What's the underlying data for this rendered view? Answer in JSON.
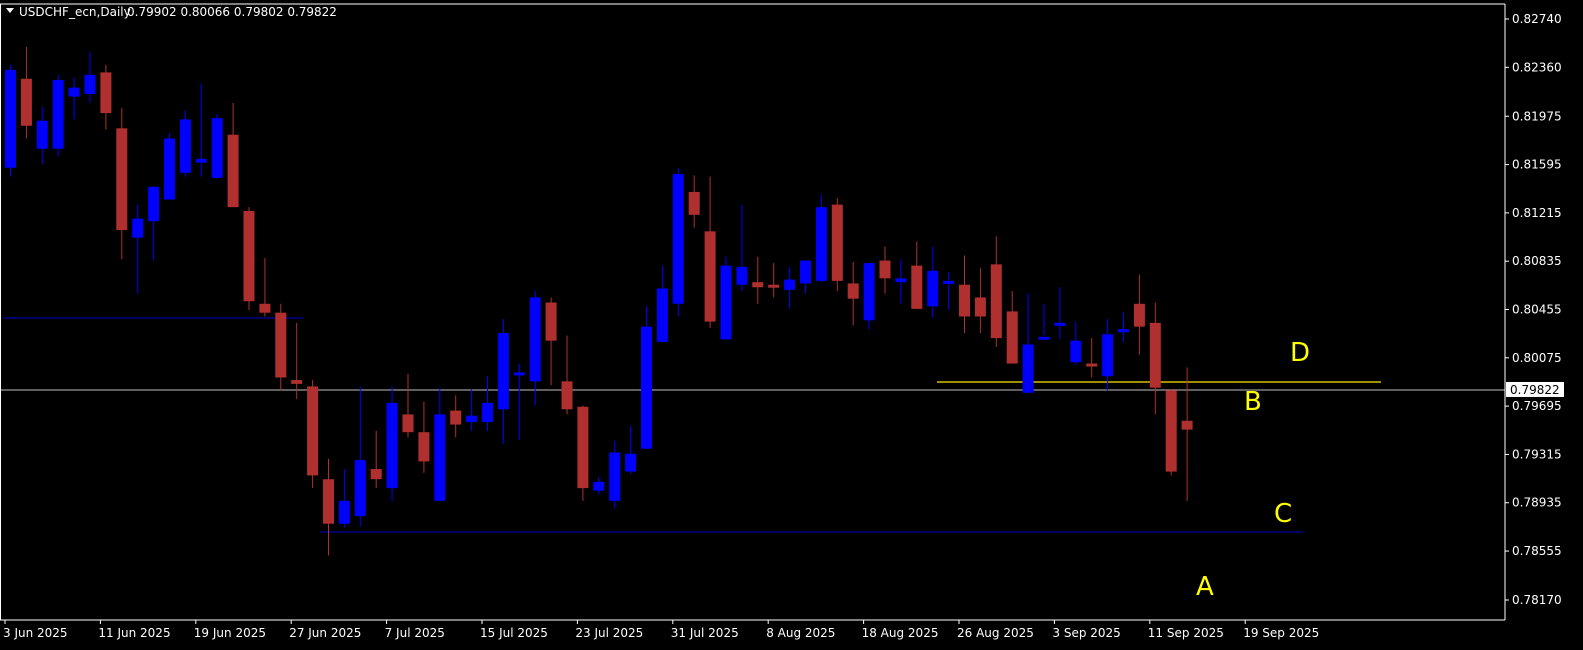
{
  "header": {
    "symbol_timeframe": "USDCHF_ecn,Daily",
    "ohlc": "0.79902 0.80066 0.79802 0.79822"
  },
  "colors": {
    "background": "#000000",
    "bull": "#0000ff",
    "bear": "#b03030",
    "wick_bull": "#0000ff",
    "wick_bear": "#b03030",
    "axis": "#ffffff",
    "hline": "#0000cc",
    "price_line": "#c0c0c0",
    "yellow_line": "#d4c000",
    "annotation": "#ffff00"
  },
  "chart_data": {
    "type": "candlestick",
    "title": "USDCHF_ecn,Daily",
    "ylim": [
      0.7799,
      0.8285
    ],
    "y_ticks": [
      "0.82740",
      "0.82360",
      "0.81975",
      "0.81595",
      "0.81215",
      "0.80835",
      "0.80455",
      "0.80075",
      "0.79695",
      "0.79315",
      "0.78935",
      "0.78555",
      "0.78170"
    ],
    "y_tick_values": [
      0.8274,
      0.8236,
      0.81975,
      0.81595,
      0.81215,
      0.80835,
      0.80455,
      0.80075,
      0.79695,
      0.79315,
      0.78935,
      0.78555,
      0.7817
    ],
    "x_ticks": [
      "3 Jun 2025",
      "11 Jun 2025",
      "19 Jun 2025",
      "27 Jun 2025",
      "7 Jul 2025",
      "15 Jul 2025",
      "23 Jul 2025",
      "31 Jul 2025",
      "8 Aug 2025",
      "18 Aug 2025",
      "26 Aug 2025",
      "3 Sep 2025",
      "11 Sep 2025",
      "19 Sep 2025"
    ],
    "x_tick_index": [
      0,
      6,
      12,
      18,
      24,
      30,
      36,
      42,
      48,
      54,
      60,
      66,
      72,
      78
    ],
    "current_price": "0.79822",
    "current_price_value": 0.79822,
    "candles": [
      {
        "o": 0.8157,
        "h": 0.8238,
        "l": 0.815,
        "c": 0.8234
      },
      {
        "o": 0.8227,
        "h": 0.8252,
        "l": 0.818,
        "c": 0.819
      },
      {
        "o": 0.8172,
        "h": 0.8205,
        "l": 0.816,
        "c": 0.8194
      },
      {
        "o": 0.8172,
        "h": 0.823,
        "l": 0.8166,
        "c": 0.8226
      },
      {
        "o": 0.8213,
        "h": 0.8228,
        "l": 0.8195,
        "c": 0.822
      },
      {
        "o": 0.8215,
        "h": 0.8248,
        "l": 0.8208,
        "c": 0.823
      },
      {
        "o": 0.8232,
        "h": 0.8238,
        "l": 0.8187,
        "c": 0.82
      },
      {
        "o": 0.8188,
        "h": 0.8204,
        "l": 0.8085,
        "c": 0.8108
      },
      {
        "o": 0.8102,
        "h": 0.8128,
        "l": 0.8058,
        "c": 0.8117
      },
      {
        "o": 0.8115,
        "h": 0.8142,
        "l": 0.8084,
        "c": 0.8142
      },
      {
        "o": 0.8132,
        "h": 0.8184,
        "l": 0.8132,
        "c": 0.818
      },
      {
        "o": 0.8153,
        "h": 0.8202,
        "l": 0.815,
        "c": 0.8195
      },
      {
        "o": 0.8161,
        "h": 0.8223,
        "l": 0.815,
        "c": 0.8164
      },
      {
        "o": 0.8149,
        "h": 0.8199,
        "l": 0.8149,
        "c": 0.8196
      },
      {
        "o": 0.8183,
        "h": 0.8208,
        "l": 0.8135,
        "c": 0.8126
      },
      {
        "o": 0.8123,
        "h": 0.8126,
        "l": 0.8045,
        "c": 0.8052
      },
      {
        "o": 0.805,
        "h": 0.8086,
        "l": 0.804,
        "c": 0.8043
      },
      {
        "o": 0.8043,
        "h": 0.805,
        "l": 0.7982,
        "c": 0.7992
      },
      {
        "o": 0.799,
        "h": 0.8035,
        "l": 0.7975,
        "c": 0.7987
      },
      {
        "o": 0.7985,
        "h": 0.799,
        "l": 0.7905,
        "c": 0.7915
      },
      {
        "o": 0.7912,
        "h": 0.7928,
        "l": 0.7852,
        "c": 0.7877
      },
      {
        "o": 0.7877,
        "h": 0.792,
        "l": 0.7874,
        "c": 0.7895
      },
      {
        "o": 0.7883,
        "h": 0.7985,
        "l": 0.7875,
        "c": 0.7927
      },
      {
        "o": 0.792,
        "h": 0.795,
        "l": 0.7905,
        "c": 0.7912
      },
      {
        "o": 0.7905,
        "h": 0.7985,
        "l": 0.7895,
        "c": 0.7972
      },
      {
        "o": 0.7963,
        "h": 0.7995,
        "l": 0.7945,
        "c": 0.7949
      },
      {
        "o": 0.7949,
        "h": 0.7973,
        "l": 0.7917,
        "c": 0.7926
      },
      {
        "o": 0.7895,
        "h": 0.7984,
        "l": 0.7895,
        "c": 0.7963
      },
      {
        "o": 0.7966,
        "h": 0.7978,
        "l": 0.7945,
        "c": 0.7955
      },
      {
        "o": 0.7957,
        "h": 0.7983,
        "l": 0.795,
        "c": 0.7962
      },
      {
        "o": 0.7957,
        "h": 0.7993,
        "l": 0.795,
        "c": 0.7972
      },
      {
        "o": 0.7967,
        "h": 0.8038,
        "l": 0.794,
        "c": 0.8027
      },
      {
        "o": 0.7994,
        "h": 0.8003,
        "l": 0.7943,
        "c": 0.7996
      },
      {
        "o": 0.7989,
        "h": 0.806,
        "l": 0.797,
        "c": 0.8055
      },
      {
        "o": 0.8051,
        "h": 0.8055,
        "l": 0.7986,
        "c": 0.8021
      },
      {
        "o": 0.7989,
        "h": 0.8025,
        "l": 0.7963,
        "c": 0.7967
      },
      {
        "o": 0.7969,
        "h": 0.797,
        "l": 0.7895,
        "c": 0.7905
      },
      {
        "o": 0.7903,
        "h": 0.7914,
        "l": 0.79,
        "c": 0.791
      },
      {
        "o": 0.7895,
        "h": 0.7942,
        "l": 0.7889,
        "c": 0.7933
      },
      {
        "o": 0.7918,
        "h": 0.7954,
        "l": 0.7916,
        "c": 0.7932
      },
      {
        "o": 0.7936,
        "h": 0.8048,
        "l": 0.7936,
        "c": 0.8032
      },
      {
        "o": 0.802,
        "h": 0.808,
        "l": 0.802,
        "c": 0.8062
      },
      {
        "o": 0.805,
        "h": 0.8157,
        "l": 0.804,
        "c": 0.8152
      },
      {
        "o": 0.8138,
        "h": 0.8151,
        "l": 0.811,
        "c": 0.812
      },
      {
        "o": 0.8107,
        "h": 0.815,
        "l": 0.8031,
        "c": 0.8036
      },
      {
        "o": 0.8022,
        "h": 0.8087,
        "l": 0.8022,
        "c": 0.808
      },
      {
        "o": 0.8065,
        "h": 0.8128,
        "l": 0.806,
        "c": 0.8079
      },
      {
        "o": 0.8067,
        "h": 0.8087,
        "l": 0.805,
        "c": 0.8063
      },
      {
        "o": 0.8065,
        "h": 0.8082,
        "l": 0.8055,
        "c": 0.8064
      },
      {
        "o": 0.8061,
        "h": 0.8079,
        "l": 0.8046,
        "c": 0.8069
      },
      {
        "o": 0.8066,
        "h": 0.8082,
        "l": 0.8058,
        "c": 0.8084
      },
      {
        "o": 0.8068,
        "h": 0.8136,
        "l": 0.8067,
        "c": 0.8126
      },
      {
        "o": 0.8128,
        "h": 0.8133,
        "l": 0.806,
        "c": 0.8068
      },
      {
        "o": 0.8066,
        "h": 0.8083,
        "l": 0.8033,
        "c": 0.8054
      },
      {
        "o": 0.8037,
        "h": 0.808,
        "l": 0.803,
        "c": 0.8082
      },
      {
        "o": 0.8084,
        "h": 0.8095,
        "l": 0.8058,
        "c": 0.807
      },
      {
        "o": 0.8067,
        "h": 0.8085,
        "l": 0.805,
        "c": 0.807
      },
      {
        "o": 0.808,
        "h": 0.8099,
        "l": 0.8046,
        "c": 0.8046
      },
      {
        "o": 0.8048,
        "h": 0.8095,
        "l": 0.8039,
        "c": 0.8076
      },
      {
        "o": 0.8068,
        "h": 0.8075,
        "l": 0.8045,
        "c": 0.8068
      },
      {
        "o": 0.8065,
        "h": 0.8088,
        "l": 0.8027,
        "c": 0.804
      },
      {
        "o": 0.8055,
        "h": 0.8078,
        "l": 0.8027,
        "c": 0.804
      },
      {
        "o": 0.8081,
        "h": 0.8103,
        "l": 0.8016,
        "c": 0.8023
      },
      {
        "o": 0.8044,
        "h": 0.806,
        "l": 0.8004,
        "c": 0.8003
      },
      {
        "o": 0.798,
        "h": 0.8058,
        "l": 0.799,
        "c": 0.8018
      },
      {
        "o": 0.8022,
        "h": 0.805,
        "l": 0.8025,
        "c": 0.8024
      },
      {
        "o": 0.8034,
        "h": 0.8063,
        "l": 0.8022,
        "c": 0.8035
      },
      {
        "o": 0.8004,
        "h": 0.8036,
        "l": 0.8002,
        "c": 0.8021
      },
      {
        "o": 0.8003,
        "h": 0.8023,
        "l": 0.7992,
        "c": 0.8001
      },
      {
        "o": 0.7993,
        "h": 0.8038,
        "l": 0.7982,
        "c": 0.8026
      },
      {
        "o": 0.803,
        "h": 0.8043,
        "l": 0.802,
        "c": 0.803
      },
      {
        "o": 0.805,
        "h": 0.8073,
        "l": 0.801,
        "c": 0.8032
      },
      {
        "o": 0.8035,
        "h": 0.8051,
        "l": 0.7963,
        "c": 0.7984
      },
      {
        "o": 0.7982,
        "h": 0.7983,
        "l": 0.7915,
        "c": 0.7918
      },
      {
        "o": 0.7958,
        "h": 0.8,
        "l": 0.7895,
        "c": 0.7951
      }
    ]
  },
  "annotations": {
    "A": "A",
    "B": "B",
    "C": "C",
    "D": "D"
  }
}
